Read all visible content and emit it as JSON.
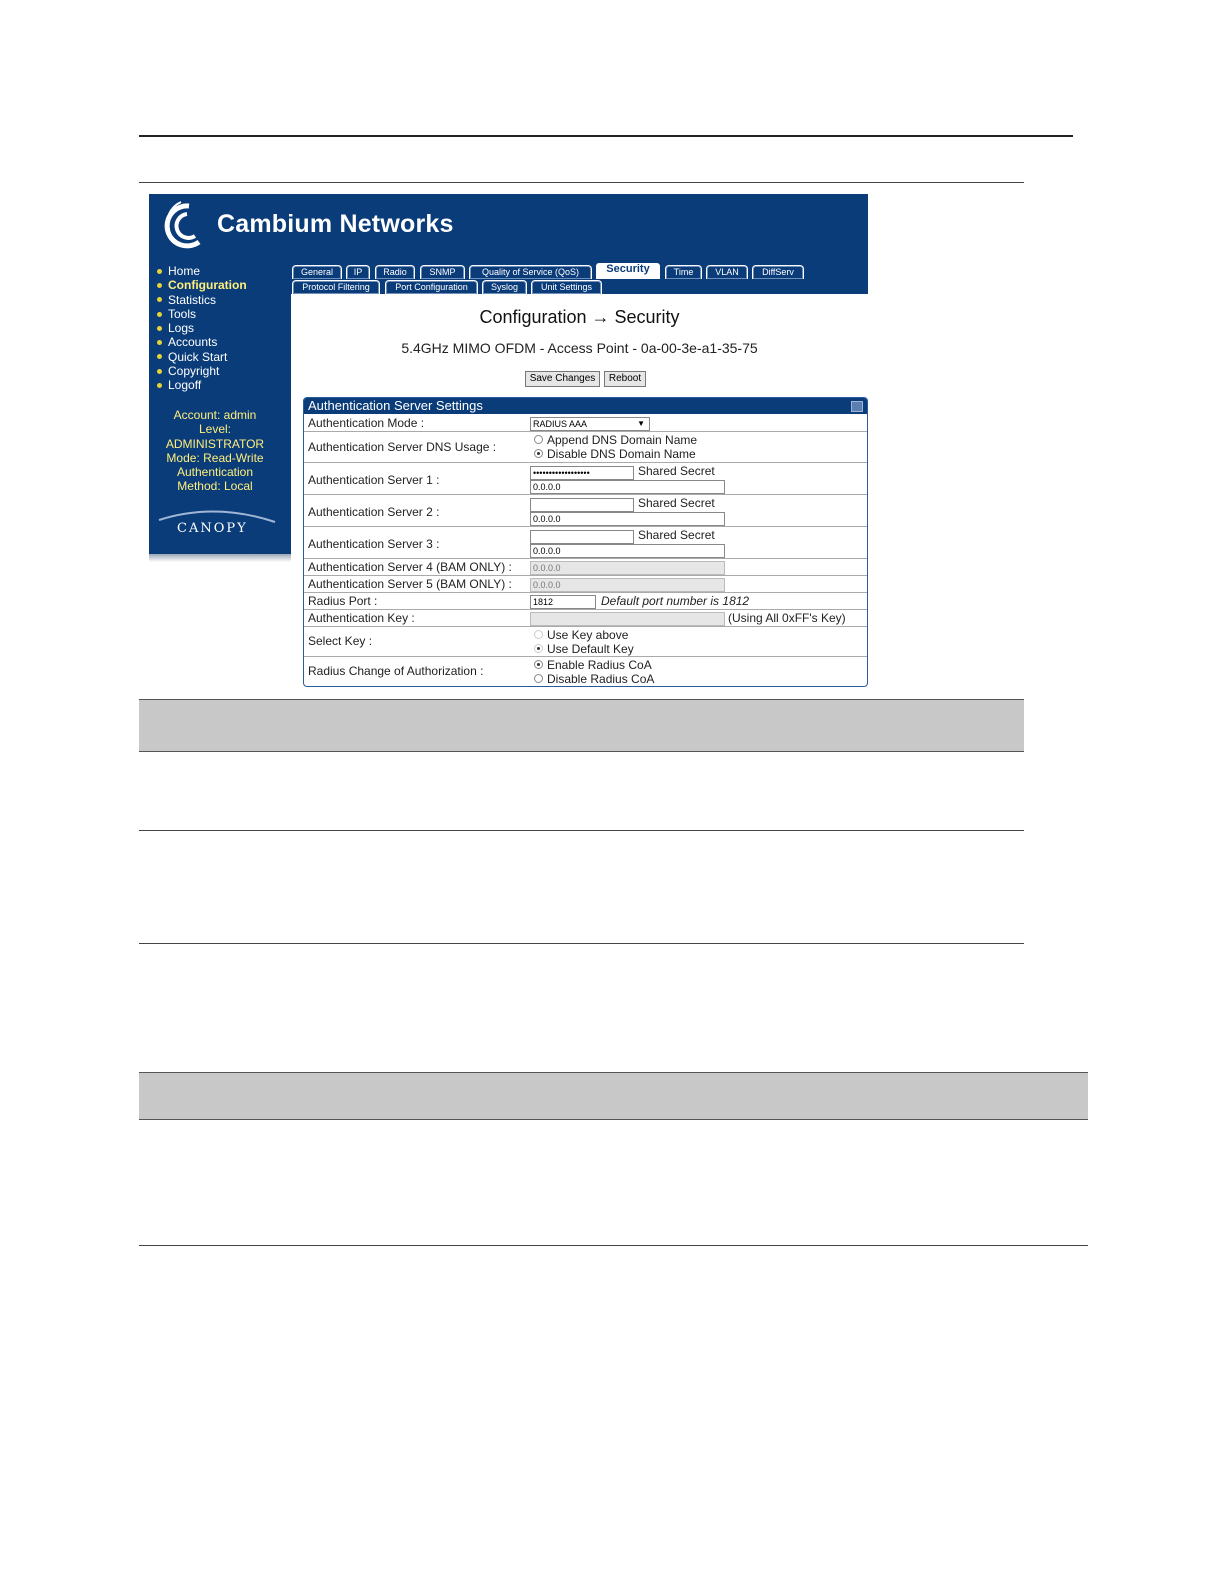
{
  "app": {
    "brand": "Cambium Networks",
    "canopy_logo": "CANOPY"
  },
  "sidebar": {
    "items": [
      {
        "label": "Home"
      },
      {
        "label": "Configuration"
      },
      {
        "label": "Statistics"
      },
      {
        "label": "Tools"
      },
      {
        "label": "Logs"
      },
      {
        "label": "Accounts"
      },
      {
        "label": "Quick Start"
      },
      {
        "label": "Copyright"
      },
      {
        "label": "Logoff"
      }
    ],
    "account_lines": [
      "Account: admin",
      "Level:",
      "ADMINISTRATOR",
      "Mode: Read-Write",
      "Authentication",
      "Method: Local"
    ]
  },
  "tabs": {
    "row1": [
      "General",
      "IP",
      "Radio",
      "SNMP",
      "Quality of Service (QoS)",
      "Security",
      "Time",
      "VLAN",
      "DiffServ"
    ],
    "row2": [
      "Protocol Filtering",
      "Port Configuration",
      "Syslog",
      "Unit Settings"
    ],
    "selected": "Security"
  },
  "page": {
    "title": "Configuration → Security",
    "subtitle": "5.4GHz MIMO OFDM - Access Point - 0a-00-3e-a1-35-75",
    "save_label": "Save Changes",
    "reboot_label": "Reboot"
  },
  "panel": {
    "title": "Authentication Server Settings",
    "auth_mode_label": "Authentication Mode :",
    "auth_mode_value": "RADIUS AAA",
    "dns_label": "Authentication Server DNS Usage :",
    "dns_opt1": "Append DNS Domain Name",
    "dns_opt2": "Disable DNS Domain Name",
    "server1_label": "Authentication Server 1 :",
    "server2_label": "Authentication Server 2 :",
    "server3_label": "Authentication Server 3 :",
    "server4_label": "Authentication Server 4 (BAM ONLY) :",
    "server5_label": "Authentication Server 5 (BAM ONLY) :",
    "shared_secret": "Shared Secret",
    "server1_secret": "••••••••••••••••••",
    "ip_value": "0.0.0.0",
    "radius_port_label": "Radius Port :",
    "radius_port_value": "1812",
    "radius_port_note": "Default port number is 1812",
    "auth_key_label": "Authentication Key :",
    "auth_key_note": "(Using All 0xFF's Key)",
    "select_key_label": "Select Key :",
    "key_opt1": "Use Key above",
    "key_opt2": "Use Default Key",
    "coa_label": "Radius Change of Authorization :",
    "coa_opt1": "Enable Radius CoA",
    "coa_opt2": "Disable Radius CoA"
  },
  "colors": {
    "brand_blue": "#0b3c7a",
    "nav_yellow": "#ffef7a"
  }
}
